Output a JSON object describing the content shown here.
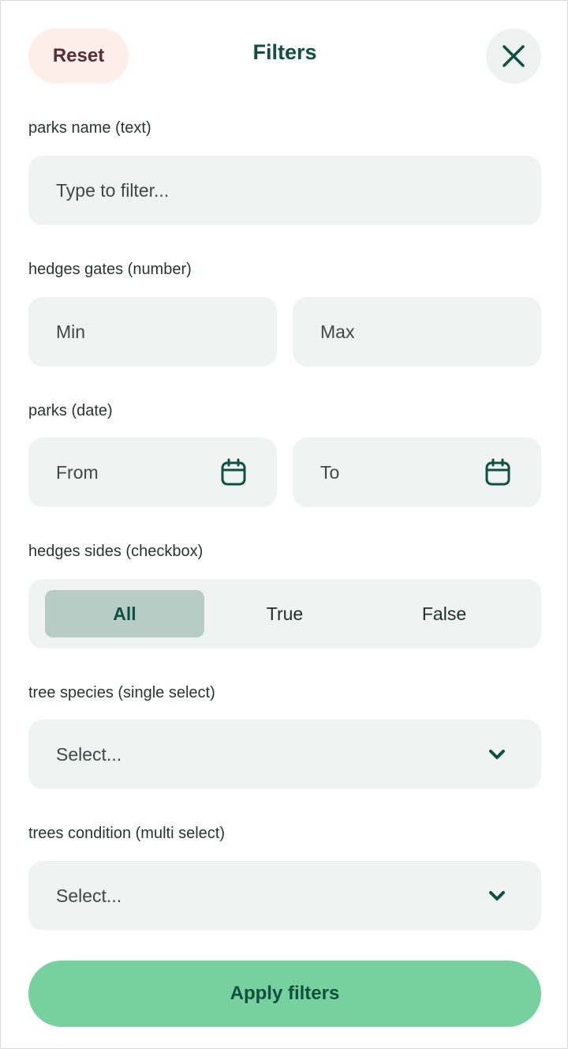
{
  "header": {
    "reset_label": "Reset",
    "title": "Filters",
    "close_icon": "close-icon"
  },
  "filters": {
    "parks_name": {
      "label": "parks name (text)",
      "placeholder": "Type to filter...",
      "value": ""
    },
    "hedges_gates": {
      "label": "hedges gates (number)",
      "min_placeholder": "Min",
      "max_placeholder": "Max"
    },
    "parks_date": {
      "label": "parks (date)",
      "from_placeholder": "From",
      "to_placeholder": "To",
      "icon": "calendar-icon"
    },
    "hedges_sides": {
      "label": "hedges sides (checkbox)",
      "options": [
        "All",
        "True",
        "False"
      ],
      "selected": "All"
    },
    "tree_species": {
      "label": "tree species (single select)",
      "value": "Select...",
      "icon": "chevron-down-icon"
    },
    "trees_condition": {
      "label": "trees condition (multi select)",
      "value": "Select...",
      "icon": "chevron-down-icon"
    }
  },
  "footer": {
    "apply_label": "Apply filters"
  },
  "colors": {
    "accent": "#76d19e",
    "title": "#0f5140",
    "reset_bg": "#fdeeea",
    "field_bg": "#eff3f2",
    "segment_active": "#b7ccc5"
  }
}
